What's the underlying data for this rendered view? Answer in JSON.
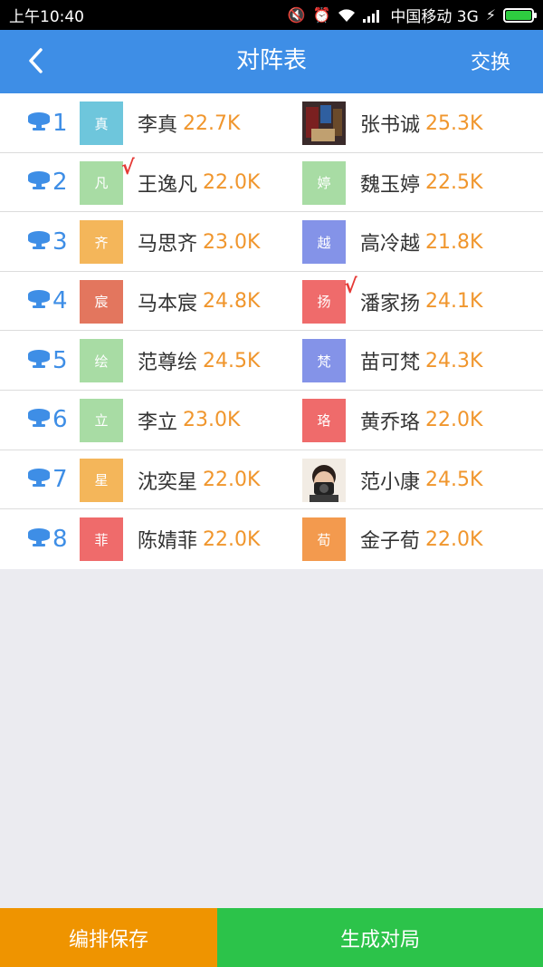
{
  "status": {
    "time": "上午10:40",
    "carrier": "中国移动 3G",
    "icons": [
      "mute-icon",
      "alarm-icon",
      "wifi-icon",
      "signal-icon",
      "charging-icon",
      "battery-icon"
    ]
  },
  "nav": {
    "back_icon": "chevron-left-icon",
    "title": "对阵表",
    "right_label": "交换"
  },
  "colors": {
    "brand": "#3e8ee6",
    "score": "#f0962d",
    "check": "#e53935",
    "save_bg": "#ef9400",
    "gen_bg": "#2cc34a"
  },
  "rows": [
    {
      "seat": "1",
      "left": {
        "initial": "真",
        "name": "李真",
        "score": "22.7K",
        "avatar_color": "#6ec6dc",
        "photo": false,
        "checked": false
      },
      "right": {
        "initial": "",
        "name": "张书诚",
        "score": "25.3K",
        "avatar_color": "#5a3b3b",
        "photo": true,
        "checked": false
      }
    },
    {
      "seat": "2",
      "left": {
        "initial": "凡",
        "name": "王逸凡",
        "score": "22.0K",
        "avatar_color": "#a8dca4",
        "photo": false,
        "checked": true
      },
      "right": {
        "initial": "婷",
        "name": "魏玉婷",
        "score": "22.5K",
        "avatar_color": "#a8dca4",
        "photo": false,
        "checked": false
      }
    },
    {
      "seat": "3",
      "left": {
        "initial": "齐",
        "name": "马思齐",
        "score": "23.0K",
        "avatar_color": "#f4b65a",
        "photo": false,
        "checked": false
      },
      "right": {
        "initial": "越",
        "name": "高冷越",
        "score": "21.8K",
        "avatar_color": "#8493e8",
        "photo": false,
        "checked": false
      }
    },
    {
      "seat": "4",
      "left": {
        "initial": "宸",
        "name": "马本宸",
        "score": "24.8K",
        "avatar_color": "#e3765e",
        "photo": false,
        "checked": false
      },
      "right": {
        "initial": "扬",
        "name": "潘家扬",
        "score": "24.1K",
        "avatar_color": "#ef6b6b",
        "photo": false,
        "checked": true
      }
    },
    {
      "seat": "5",
      "left": {
        "initial": "绘",
        "name": "范尊绘",
        "score": "24.5K",
        "avatar_color": "#a8dca4",
        "photo": false,
        "checked": false
      },
      "right": {
        "initial": "梵",
        "name": "苗可梵",
        "score": "24.3K",
        "avatar_color": "#8493e8",
        "photo": false,
        "checked": false
      }
    },
    {
      "seat": "6",
      "left": {
        "initial": "立",
        "name": "李立",
        "score": "23.0K",
        "avatar_color": "#a8dca4",
        "photo": false,
        "checked": false
      },
      "right": {
        "initial": "珞",
        "name": "黄乔珞",
        "score": "22.0K",
        "avatar_color": "#ef6b6b",
        "photo": false,
        "checked": false
      }
    },
    {
      "seat": "7",
      "left": {
        "initial": "星",
        "name": "沈奕星",
        "score": "22.0K",
        "avatar_color": "#f4b65a",
        "photo": false,
        "checked": false
      },
      "right": {
        "initial": "",
        "name": "范小康",
        "score": "24.5K",
        "avatar_color": "#e8d7c8",
        "photo": true,
        "checked": false
      }
    },
    {
      "seat": "8",
      "left": {
        "initial": "菲",
        "name": "陈婧菲",
        "score": "22.0K",
        "avatar_color": "#ef6b6b",
        "photo": false,
        "checked": false
      },
      "right": {
        "initial": "荀",
        "name": "金子荀",
        "score": "22.0K",
        "avatar_color": "#f39a4e",
        "photo": false,
        "checked": false
      }
    }
  ],
  "footer": {
    "save_label": "编排保存",
    "generate_label": "生成对局"
  }
}
